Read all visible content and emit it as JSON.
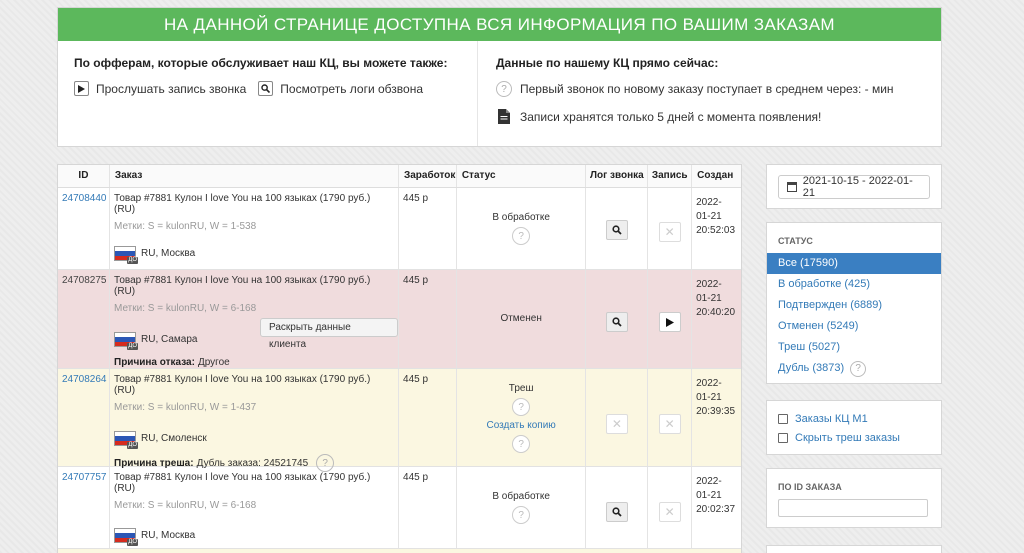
{
  "banner": {
    "title": "НА ДАННОЙ СТРАНИЦЕ ДОСТУПНА ВСЯ ИНФОРМАЦИЯ ПО ВАШИМ ЗАКАЗАМ"
  },
  "info": {
    "left_heading": "По офферам, которые обслуживает наш КЦ, вы можете также:",
    "listen_label": "Прослушать запись звонка",
    "logs_label": "Посмотреть логи обзвона",
    "right_heading": "Данные по нашему КЦ прямо сейчас:",
    "first_call_text": "Первый звонок по новому заказу поступает в среднем через: - мин",
    "records_text": "Записи хранятся только 5 дней с момента появления!"
  },
  "table": {
    "headers": {
      "id": "ID",
      "order": "Заказ",
      "earned": "Заработок",
      "status": "Статус",
      "call_log": "Лог звонка",
      "record": "Запись",
      "created": "Создан"
    },
    "rows": [
      {
        "id": "24708440",
        "product": "Товар #7881 Кулон I love You на 100 языках (1790 руб.) (RU)",
        "tags": "Метки: S = kulonRU, W = 1-538",
        "geo": "RU, Москва",
        "earned": "445 р",
        "status": "В обработке",
        "date": "2022-",
        "date2": "01-21",
        "time": "20:52:03"
      },
      {
        "id": "24708275",
        "product": "Товар #7881 Кулон I love You на 100 языках (1790 руб.) (RU)",
        "tags": "Метки: S = kulonRU, W = 6-168",
        "geo": "RU, Самара",
        "earned": "445 р",
        "status": "Отменен",
        "reveal_btn": "Раскрыть данные клиента",
        "reason_label": "Причина отказа:",
        "reason_value": "Другое",
        "date": "2022-",
        "date2": "01-21",
        "time": "20:40:20"
      },
      {
        "id": "24708264",
        "product": "Товар #7881 Кулон I love You на 100 языках (1790 руб.) (RU)",
        "tags": "Метки: S = kulonRU, W = 1-437",
        "geo": "RU, Смоленск",
        "earned": "445 р",
        "status": "Треш",
        "status_link": "Создать копию",
        "reason_label": "Причина треша:",
        "reason_value": "Дубль заказа: 24521745",
        "date": "2022-",
        "date2": "01-21",
        "time": "20:39:35"
      },
      {
        "id": "24707757",
        "product": "Товар #7881 Кулон I love You на 100 языках (1790 руб.) (RU)",
        "tags": "Метки: S = kulonRU, W = 6-168",
        "geo": "RU, Москва",
        "earned": "445 р",
        "status": "В обработке",
        "date": "2022-",
        "date2": "01-21",
        "time": "20:02:37"
      }
    ],
    "flag_badge": "ДО"
  },
  "sidebar": {
    "date_range": "2021-10-15 - 2022-01-21",
    "status_title": "СТАТУС",
    "statuses": [
      "Все (17590)",
      "В обработке (425)",
      "Подтвержден (6889)",
      "Отменен (5249)",
      "Треш (5027)",
      "Дубль (3873)"
    ],
    "filter_kc": "Заказы КЦ М1",
    "filter_trash": "Скрыть треш заказы",
    "id_search_title": "ПО ID ЗАКАЗА"
  },
  "icons": {
    "question": "question-icon",
    "search": "search-icon",
    "play": "play-icon",
    "close": "close-icon",
    "file": "file-icon",
    "calendar": "calendar-icon"
  },
  "colors": {
    "banner": "#5cb85c",
    "link": "#337ab7",
    "active": "#3a7fc2",
    "cancelled_row": "#f0dcdd",
    "trash_row": "#fbf7e1"
  }
}
